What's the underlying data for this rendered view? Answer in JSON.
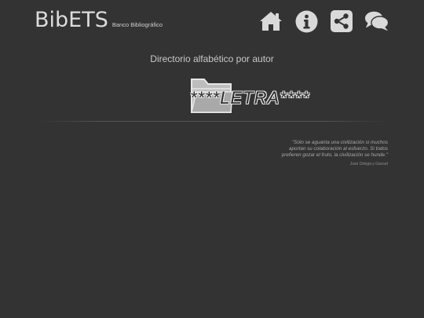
{
  "header": {
    "logo_text": "BibETS",
    "logo_subtitle": "Banco Bibliográfico",
    "nav_icons": [
      "home-icon",
      "info-icon",
      "share-icon",
      "comments-icon"
    ]
  },
  "main": {
    "title": "Directorio alfabético por autor",
    "letter_label": "****LETRA****",
    "folder_icon": "folder-icon"
  },
  "quote": {
    "text": "\"Sólo se aguanta una civilización si muchos aportan su colaboración al esfuerzo. Si todos prefieren gozar el fruto, la civilización se hunde.\"",
    "author": "José Ortega y Gasset"
  },
  "colors": {
    "background": "#333333",
    "icon": "#d9d9d9",
    "text": "#c8c8c8"
  }
}
